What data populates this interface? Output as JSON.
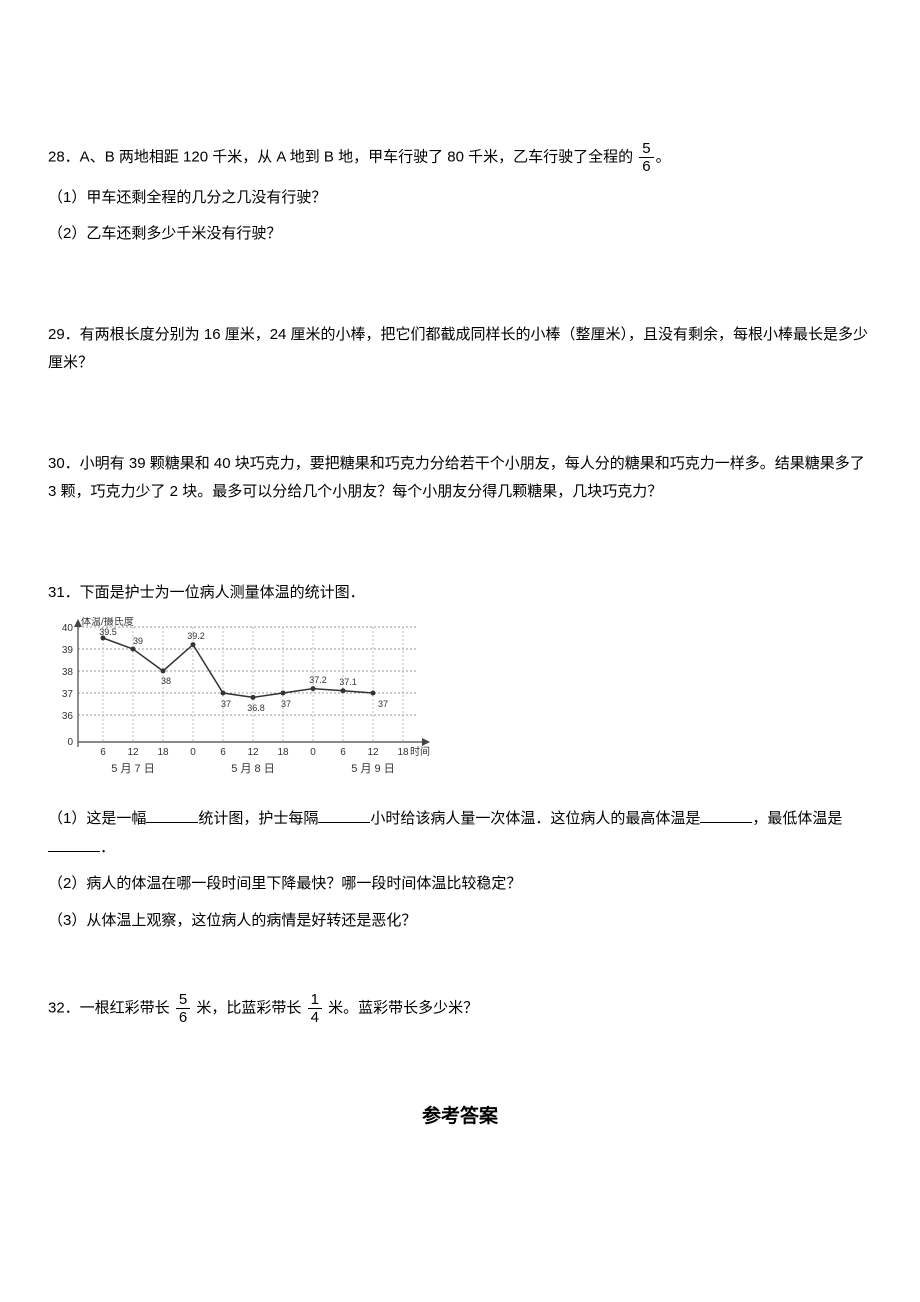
{
  "q28": {
    "stem_a": "28．A、B 两地相距 120 千米，从 A 地到 B 地，甲车行驶了 80 千米，乙车行驶了全程的",
    "frac_num": "5",
    "frac_den": "6",
    "stem_b": "。",
    "sub1": "（1）甲车还剩全程的几分之几没有行驶？",
    "sub2": "（2）乙车还剩多少千米没有行驶？"
  },
  "q29": {
    "stem": "29．有两根长度分别为 16 厘米，24 厘米的小棒，把它们都截成同样长的小棒（整厘米），且没有剩余，每根小棒最长是多少厘米？"
  },
  "q30": {
    "stem": "30．小明有 39 颗糖果和 40 块巧克力，要把糖果和巧克力分给若干个小朋友，每人分的糖果和巧克力一样多。结果糖果多了 3 颗，巧克力少了 2 块。最多可以分给几个小朋友？每个小朋友分得几颗糖果，几块巧克力？"
  },
  "q31": {
    "stem": "31．下面是护士为一位病人测量体温的统计图．",
    "sub1_a": "（1）这是一幅",
    "sub1_b": "统计图，护士每隔",
    "sub1_c": "小时给该病人量一次体温．这位病人的最高体温是",
    "sub1_d": "，最低体温是",
    "sub1_e": "．",
    "sub2": "（2）病人的体温在哪一段时间里下降最快？哪一段时间体温比较稳定？",
    "sub3": "（3）从体温上观察，这位病人的病情是好转还是恶化？"
  },
  "q32": {
    "a": "32．一根红彩带长",
    "frac1_num": "5",
    "frac1_den": "6",
    "b": "米，比蓝彩带长",
    "frac2_num": "1",
    "frac2_den": "4",
    "c": "米。蓝彩带长多少米？"
  },
  "answer_title": "参考答案",
  "chart_data": {
    "type": "line",
    "title": "体温/摄氏度",
    "xlabel": "时间",
    "ylim": [
      0,
      40
    ],
    "y_ticks": [
      0,
      36,
      37,
      38,
      39,
      40
    ],
    "x_ticks": [
      "6",
      "12",
      "18",
      "0",
      "6",
      "12",
      "18",
      "0",
      "6",
      "12",
      "18"
    ],
    "x_groups": [
      "5 月 7 日",
      "5 月 8 日",
      "5 月 9 日"
    ],
    "values": [
      39.5,
      39,
      38,
      39.2,
      37,
      36.8,
      37,
      37.2,
      37.1,
      37,
      null
    ],
    "value_labels": [
      "39.5",
      "39",
      "38",
      "39.2",
      "37",
      "36.8",
      "37",
      "37.2",
      "37.1",
      "37",
      ""
    ]
  }
}
